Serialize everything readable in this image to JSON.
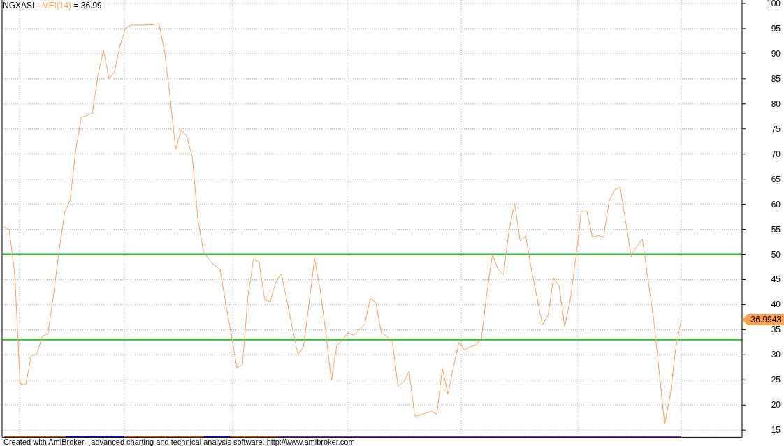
{
  "chart": {
    "title": {
      "symbol": "NGXASI",
      "separator": "-",
      "reading": "= 36.99"
    },
    "value_label": "36.9943",
    "chart_data": {
      "type": "line",
      "ylim": [
        14,
        100
      ],
      "yticks": [
        15,
        20,
        25,
        30,
        35,
        40,
        45,
        50,
        55,
        60,
        65,
        70,
        75,
        80,
        85,
        90,
        95,
        100
      ],
      "series": [
        {
          "name": "MFI(14)",
          "color": "#ffa050",
          "values": [
            55.5,
            55,
            46.5,
            24.2,
            24,
            29.8,
            30.2,
            33.7,
            34.2,
            42,
            50.6,
            58.3,
            60.8,
            70.8,
            77.3,
            77.7,
            78.2,
            85.7,
            90.7,
            85,
            86.5,
            91.7,
            95.1,
            95.7,
            95.7,
            95.7,
            95.7,
            95.8,
            96,
            90.3,
            81.2,
            71,
            74.8,
            73.5,
            69.3,
            56.9,
            50.6,
            49,
            47.8,
            47,
            40.2,
            34,
            27.4,
            28,
            41.6,
            49,
            48.5,
            41,
            40.6,
            44.4,
            46.2,
            40.9,
            35.3,
            30,
            31.6,
            40.2,
            49.2,
            43,
            34.6,
            24.9,
            31.8,
            33,
            34.4,
            33.9,
            35,
            36,
            41.2,
            40.5,
            34.4,
            33.7,
            32.5,
            23.8,
            24.5,
            26.7,
            17.8,
            18,
            18.4,
            18.7,
            18.2,
            27.3,
            22.1,
            27.7,
            32.5,
            30.9,
            31.6,
            31.9,
            33.1,
            42.3,
            50,
            47.1,
            46,
            54.8,
            60.1,
            52.7,
            53.7,
            47.1,
            41.6,
            36,
            37.8,
            45.3,
            43.8,
            35.6,
            40.9,
            49.2,
            58.6,
            58.6,
            53.4,
            53.8,
            53.4,
            60.6,
            62.9,
            63.4,
            56.5,
            49.5,
            51.7,
            53,
            45.1,
            37.4,
            27,
            16.1,
            21.8,
            31.2,
            37
          ]
        }
      ],
      "grid": true,
      "ref_lines": [
        {
          "axis": "y",
          "value": 50,
          "color": "#20c020"
        },
        {
          "axis": "y",
          "value": 33,
          "color": "#20c020"
        }
      ]
    }
  },
  "footer": {
    "text": "Created with AmiBroker - advanced charting and technical analysis software. http://www.amibroker.com"
  }
}
